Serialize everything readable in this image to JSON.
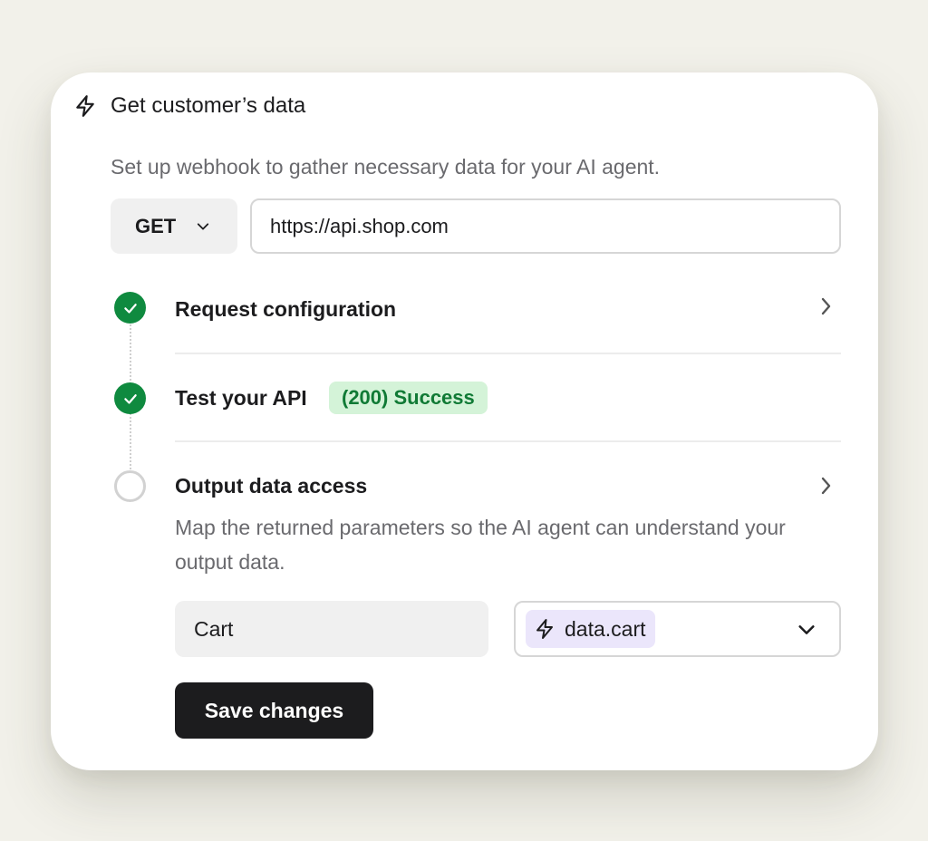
{
  "card": {
    "title": "Get customer’s data",
    "title_icon": "lightning-icon",
    "subtitle": "Set up webhook to gather necessary data for your AI agent."
  },
  "request": {
    "method": "GET",
    "url": "https://api.shop.com"
  },
  "steps": [
    {
      "title": "Request configuration",
      "status": "complete",
      "icon": "check-icon"
    },
    {
      "title": "Test your API",
      "status": "complete",
      "icon": "check-icon",
      "badge": "(200) Success"
    },
    {
      "title": "Output data access",
      "status": "pending",
      "description": "Map the returned parameters so the AI agent can understand your output data."
    }
  ],
  "mapping": {
    "name_value": "Cart",
    "variable_value": "data.cart",
    "variable_icon": "lightning-icon"
  },
  "save_label": "Save changes",
  "colors": {
    "success_green": "#0f8a3f",
    "badge_bg": "#d4f3d8",
    "badge_text": "#107a35",
    "chip_bg": "#ebe6fb",
    "primary_button": "#1c1c1e",
    "page_bg": "#f2f1ea"
  }
}
